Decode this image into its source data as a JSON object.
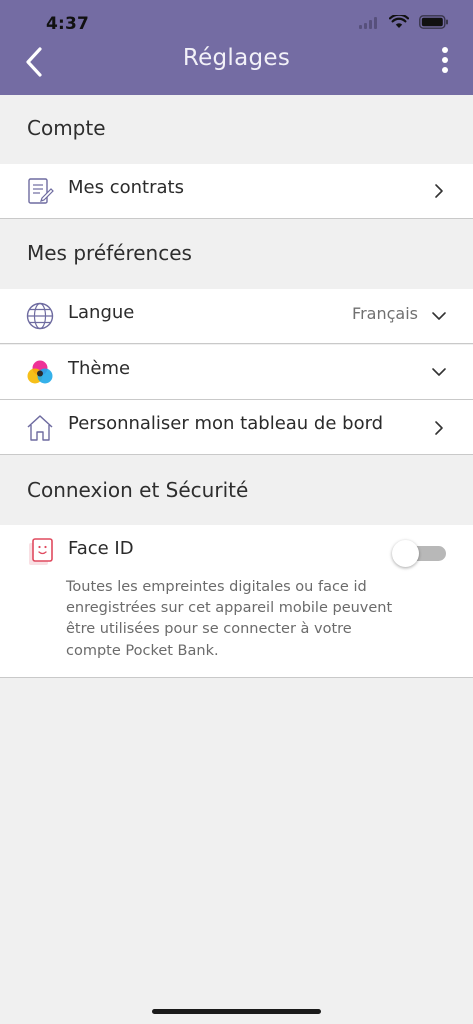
{
  "status_bar": {
    "time": "4:37"
  },
  "header": {
    "title": "Réglages",
    "bg_color": "#746ca3"
  },
  "sections": {
    "account": {
      "title": "Compte"
    },
    "preferences": {
      "title": "Mes préférences"
    },
    "security": {
      "title": "Connexion et Sécurité"
    }
  },
  "rows": {
    "contracts": {
      "label": "Mes contrats",
      "icon": "document-icon"
    },
    "language": {
      "label": "Langue",
      "value": "Français",
      "icon": "globe-icon"
    },
    "theme": {
      "label": "Thème",
      "icon": "color-palette-icon"
    },
    "dashboard": {
      "label": "Personnaliser mon tableau de bord",
      "icon": "home-icon"
    },
    "face_id": {
      "label": "Face ID",
      "icon": "face-id-icon",
      "enabled": false,
      "description": "Toutes les empreintes digitales ou face id enregistrées sur cet appareil mobile peuvent être utilisées pour se connecter à votre compte Pocket Bank."
    }
  }
}
